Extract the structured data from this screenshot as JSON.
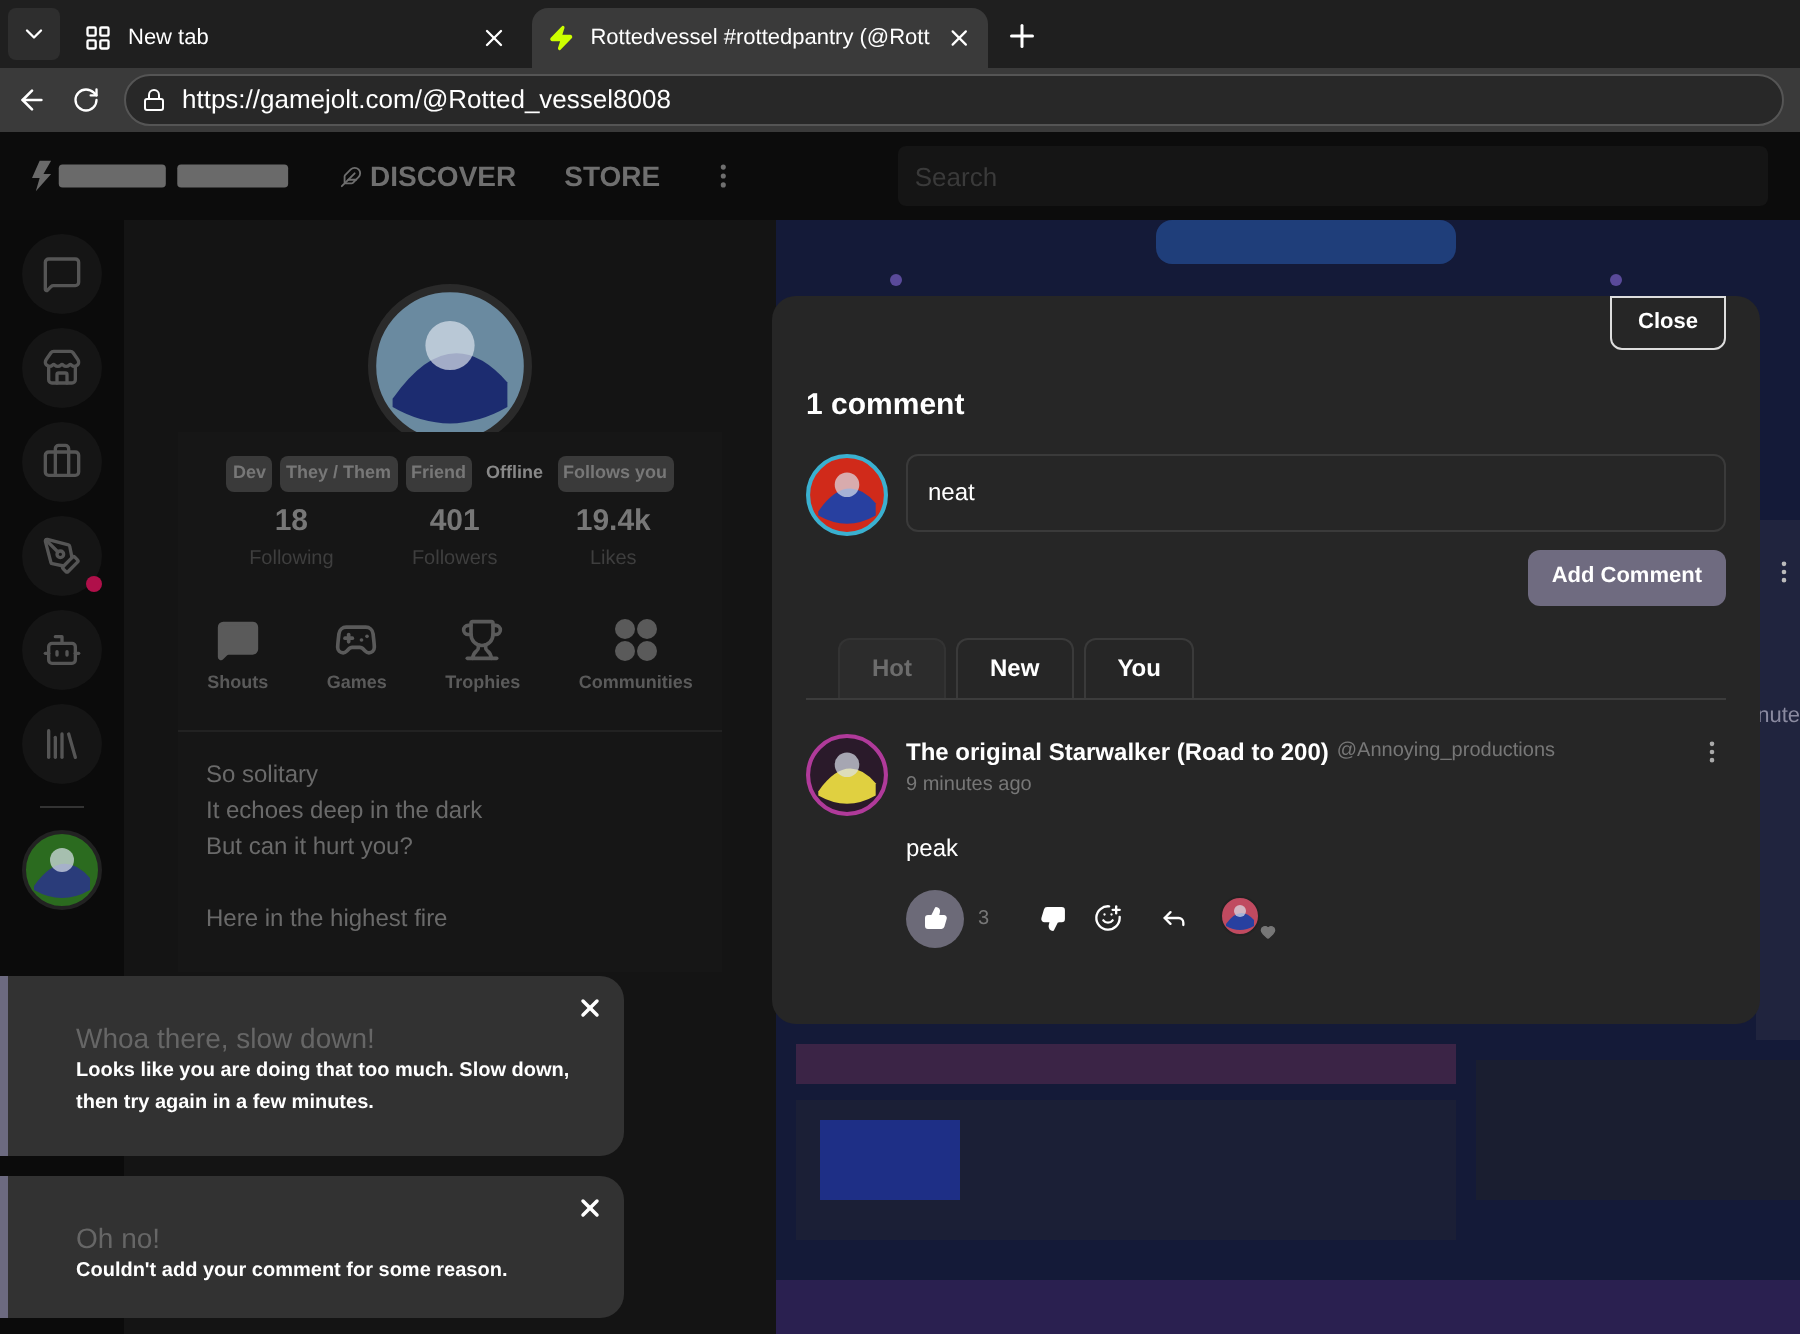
{
  "browser": {
    "tabs": [
      {
        "title": "New tab",
        "selected": false,
        "kind": "newtab"
      },
      {
        "title": "Rottedvessel #rottedpantry (@Rott",
        "selected": true,
        "kind": "site"
      }
    ],
    "url": "https://gamejolt.com/@Rotted_vessel8008"
  },
  "header": {
    "nav": [
      {
        "label": "DISCOVER",
        "kind": "discover"
      },
      {
        "label": "STORE",
        "kind": "plain"
      }
    ],
    "search": {
      "placeholder": "Search"
    }
  },
  "sidebar": {
    "items": [
      {
        "kind": "chat",
        "badge": false
      },
      {
        "kind": "store",
        "badge": false
      },
      {
        "kind": "bag",
        "badge": false
      },
      {
        "kind": "quest",
        "badge": true
      },
      {
        "kind": "robot",
        "badge": false
      },
      {
        "kind": "library",
        "badge": false
      }
    ]
  },
  "profile": {
    "tags": [
      {
        "label": "Dev",
        "kind": "tag"
      },
      {
        "label": "They / Them",
        "kind": "tag"
      },
      {
        "label": "Friend",
        "kind": "tag"
      },
      {
        "label": "Offline",
        "kind": "status"
      },
      {
        "label": "Follows you",
        "kind": "tag"
      }
    ],
    "stats": [
      {
        "value": "18",
        "label": "Following"
      },
      {
        "value": "401",
        "label": "Followers"
      },
      {
        "value": "19.4k",
        "label": "Likes"
      }
    ],
    "nav": [
      {
        "label": "Shouts",
        "kind": "shouts"
      },
      {
        "label": "Games",
        "kind": "games"
      },
      {
        "label": "Trophies",
        "kind": "trophies"
      },
      {
        "label": "Communities",
        "kind": "communities"
      }
    ],
    "bio": [
      [
        "So solitary",
        "It echoes deep in the dark",
        "But can it hurt you?"
      ],
      [
        "Here in the highest fire"
      ]
    ]
  },
  "background": {
    "fragment": "nute"
  },
  "modal": {
    "close": "Close",
    "title": "1 comment",
    "input": {
      "value": "neat"
    },
    "submit": "Add Comment",
    "tabs": [
      {
        "label": "Hot",
        "selected": true
      },
      {
        "label": "New",
        "selected": false
      },
      {
        "label": "You",
        "selected": false
      }
    ],
    "comments": [
      {
        "author": "The original Starwalker (Road to 200)",
        "handle": "@Annoying_productions",
        "time": "9 minutes ago",
        "text": "peak",
        "likes": "3",
        "liked": true
      }
    ]
  },
  "toasts": [
    {
      "title": "Whoa there, slow down!",
      "message": "Looks like you are doing that too much. Slow down, then try again in a few minutes."
    },
    {
      "title": "Oh no!",
      "message": "Couldn't add your comment for some reason."
    }
  ]
}
